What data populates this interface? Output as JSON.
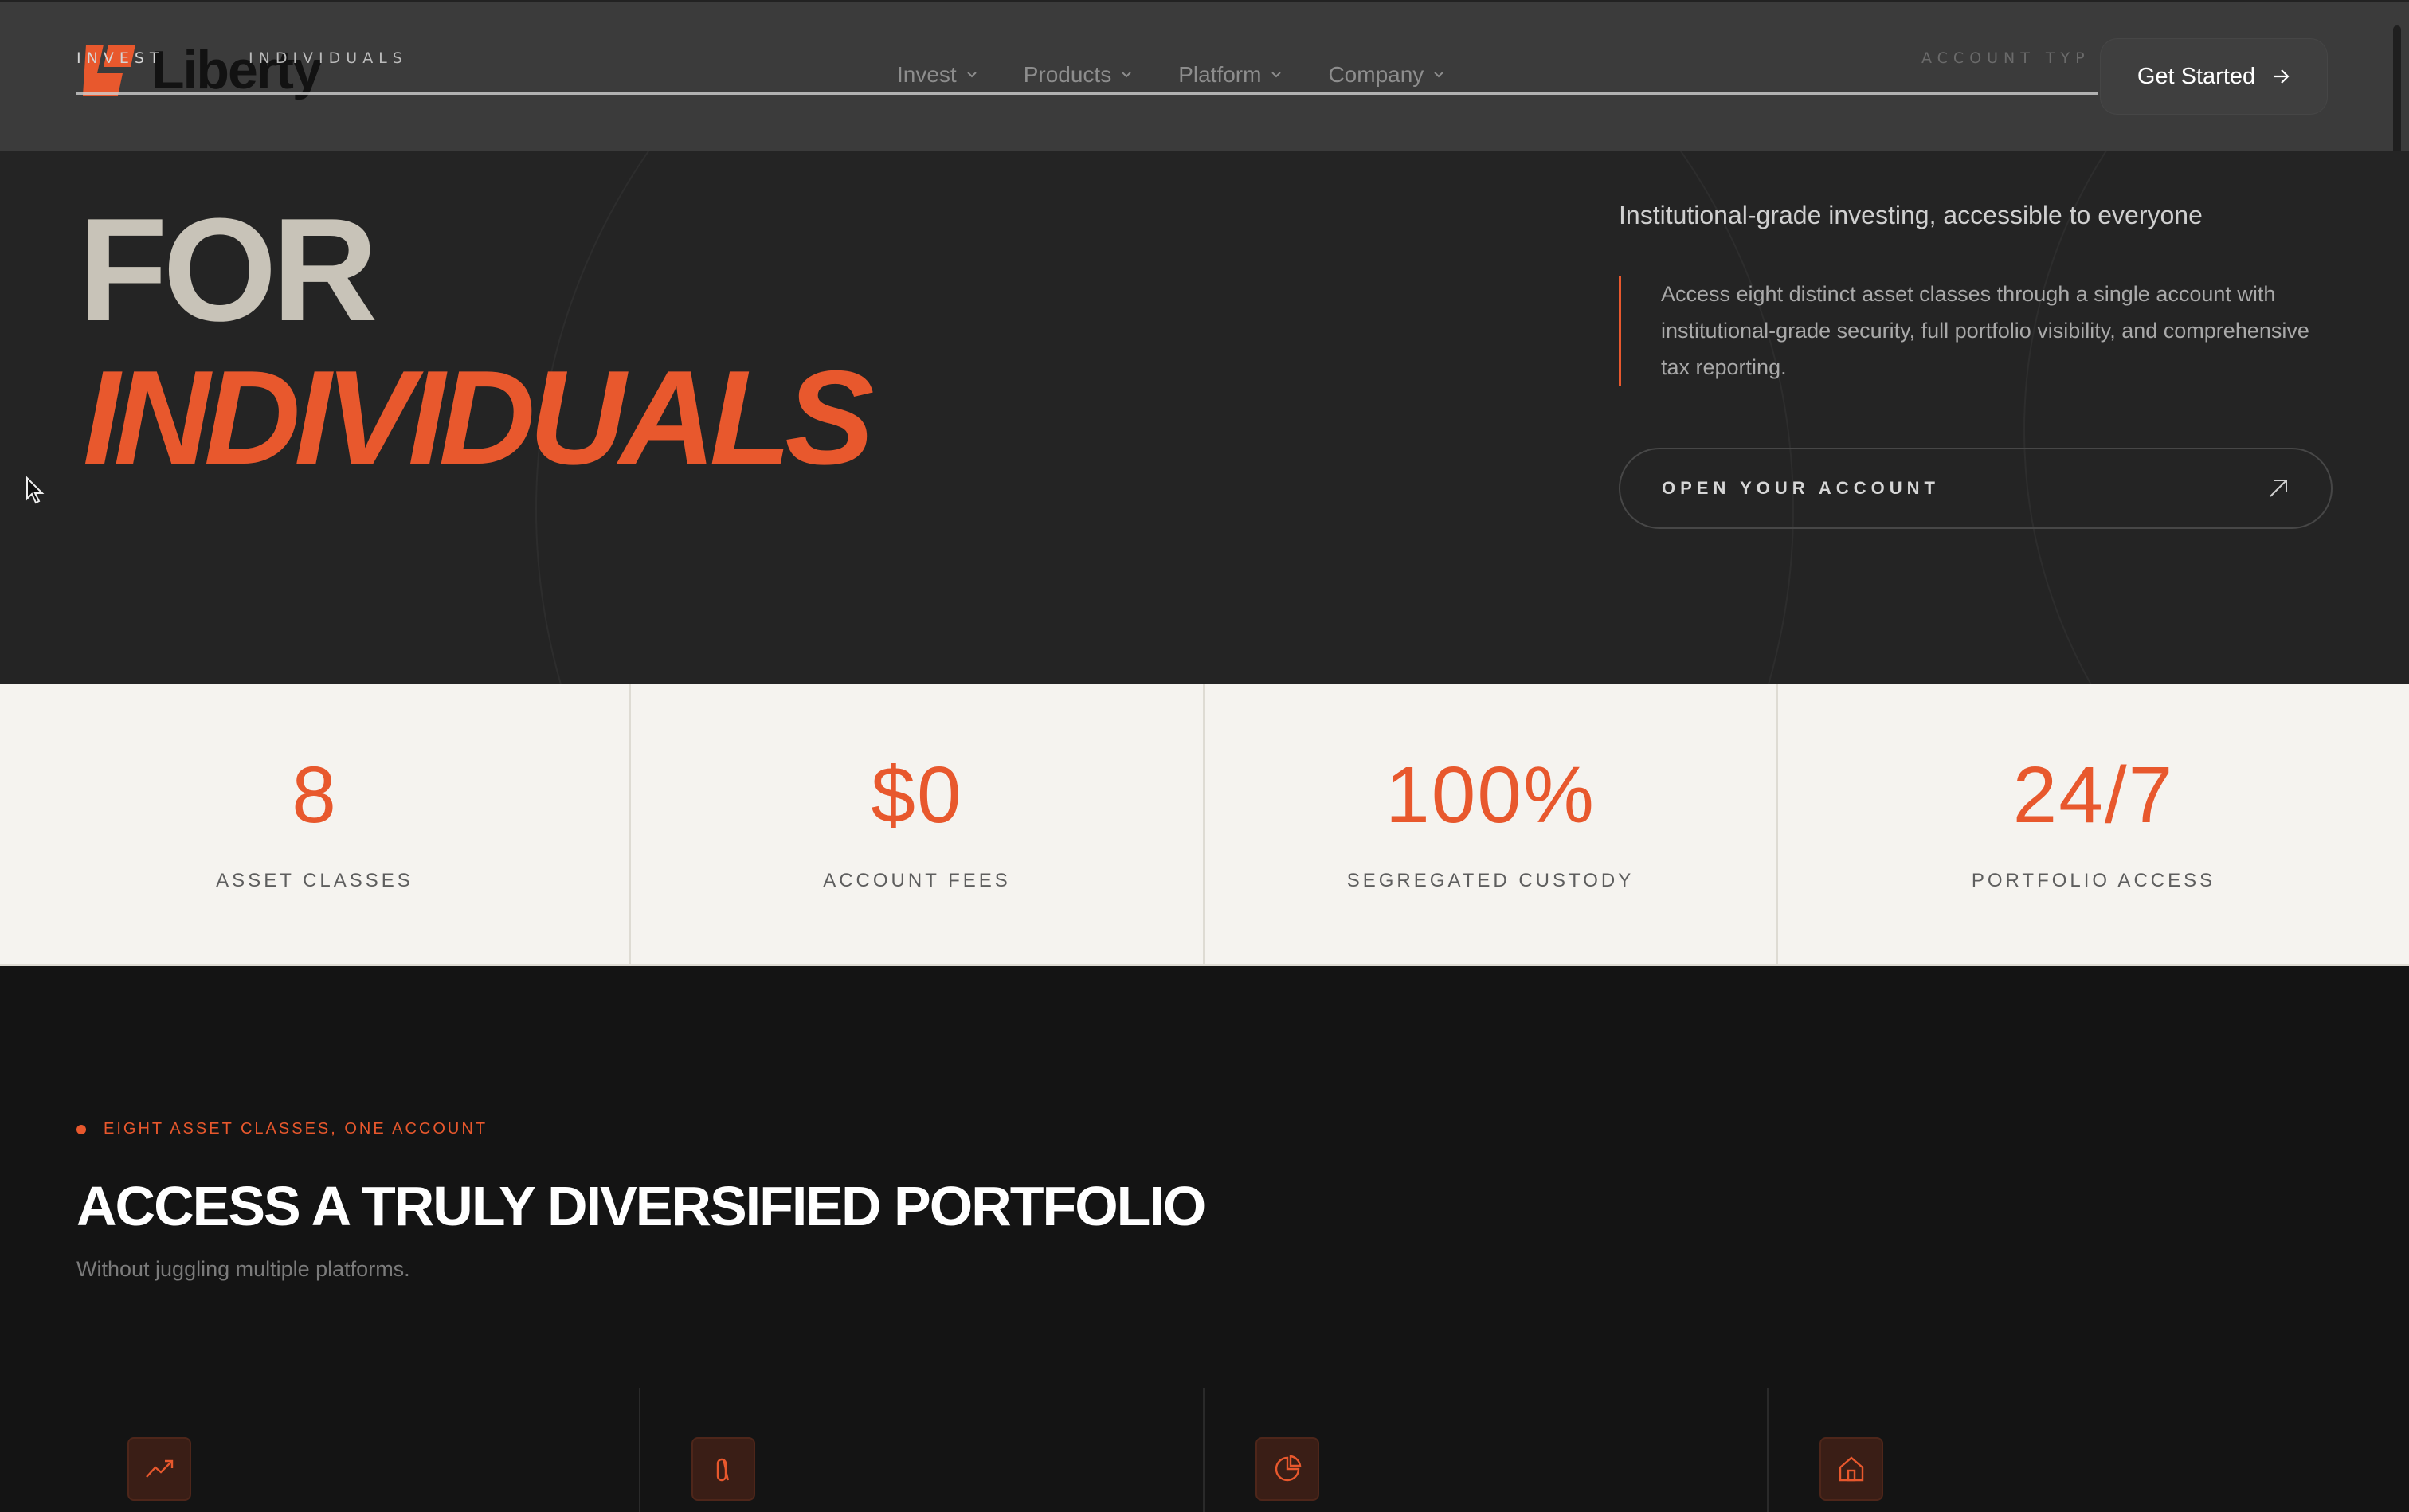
{
  "header": {
    "brand": "Liberty",
    "crumbs": [
      "INVEST",
      "INDIVIDUALS",
      "ACCOUNT TYP"
    ],
    "nav": [
      {
        "label": "Invest"
      },
      {
        "label": "Products"
      },
      {
        "label": "Platform"
      },
      {
        "label": "Company"
      }
    ],
    "cta_label": "Get Started"
  },
  "hero": {
    "title_line1": "FOR",
    "title_line2": "INDIVIDUALS",
    "lead": "Institutional-grade investing, accessible to everyone",
    "description": "Access eight distinct asset classes through a single account with institutional-grade security, full portfolio visibility, and comprehensive tax reporting.",
    "button_label": "OPEN YOUR ACCOUNT"
  },
  "stats": [
    {
      "value": "8",
      "label": "ASSET CLASSES"
    },
    {
      "value": "$0",
      "label": "ACCOUNT FEES"
    },
    {
      "value": "100%",
      "label": "SEGREGATED CUSTODY"
    },
    {
      "value": "24/7",
      "label": "PORTFOLIO ACCESS"
    }
  ],
  "diversify": {
    "eyebrow": "EIGHT ASSET CLASSES, ONE ACCOUNT",
    "title": "ACCESS A TRULY DIVERSIFIED PORTFOLIO",
    "subtitle": "Without juggling multiple platforms.",
    "asset_icons": [
      "trending-up-icon",
      "bar-icon",
      "pie-chart-icon",
      "home-icon"
    ]
  },
  "colors": {
    "accent": "#e8582d",
    "header_bg": "#3b3b3b",
    "hero_bg": "#242424",
    "stats_bg": "#f5f3ef",
    "page_bg": "#141414"
  }
}
